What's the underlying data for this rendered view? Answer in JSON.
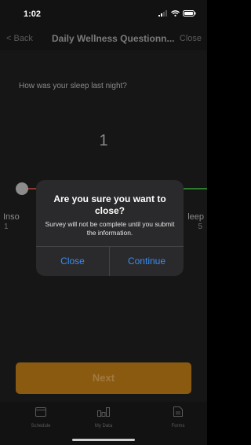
{
  "status_bar": {
    "time": "1:02"
  },
  "nav": {
    "back_label": "< Back",
    "title": "Daily Wellness Questionn...",
    "close_label": "Close"
  },
  "question": {
    "text": "How was your sleep last night?",
    "value": "1",
    "min_label": "Inso",
    "min_value": "1",
    "max_label": "leep",
    "max_value": "5"
  },
  "next_button": {
    "label": "Next"
  },
  "tabs": [
    {
      "label": "Schedule",
      "icon": "schedule-icon"
    },
    {
      "label": "My Data",
      "icon": "chart-icon"
    },
    {
      "label": "Forms",
      "icon": "forms-icon"
    }
  ],
  "alert": {
    "title": "Are you sure you want to close?",
    "message": "Survey will not be complete until you submit the information.",
    "close_label": "Close",
    "continue_label": "Continue"
  },
  "colors": {
    "accent": "#3b8cf0",
    "next_button": "#8a5a10",
    "track_low": "#8a3a2a",
    "track_high": "#2e7a2e"
  }
}
